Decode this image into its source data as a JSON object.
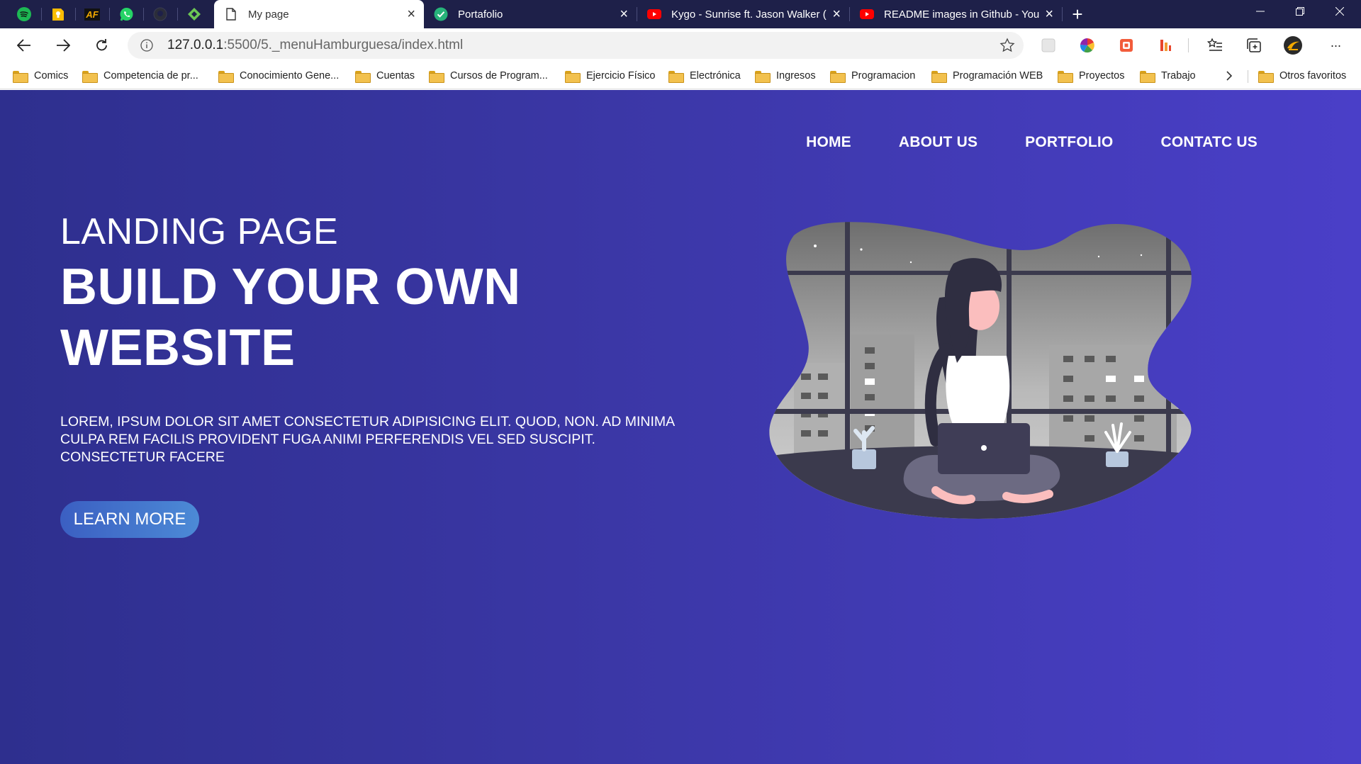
{
  "browser": {
    "tabs": [
      {
        "title": "My page",
        "active": true,
        "favicon": "page-icon"
      },
      {
        "title": "Portafolio",
        "active": false,
        "favicon": "check-circle-icon"
      },
      {
        "title": "Kygo - Sunrise ft. Jason Walker (O",
        "active": false,
        "favicon": "youtube-icon"
      },
      {
        "title": "README images in Github - You",
        "active": false,
        "favicon": "youtube-icon"
      }
    ],
    "pinned_tabs": [
      "spotify-icon",
      "keep-icon",
      "af-icon",
      "whatsapp-icon",
      "github-icon",
      "feedly-icon"
    ],
    "pinned_af_label": "AF",
    "close_glyph": "×",
    "new_tab_glyph": "+",
    "url": {
      "host": "127.0.0.1",
      "path": ":5500/5._menuHamburguesa/index.html"
    },
    "more_glyph": "···",
    "bookmarks": [
      "Comics",
      "Competencia de pr...",
      "Conocimiento Gene...",
      "Cuentas",
      "Cursos de Program...",
      "Ejercicio Físico",
      "Electrónica",
      "Ingresos",
      "Programacion",
      "Programación WEB",
      "Proyectos",
      "Trabajo"
    ],
    "other_bookmarks": "Otros favoritos",
    "colors": {
      "titlebar": "#1e2049",
      "accent": "#4a3fc8"
    }
  },
  "page": {
    "nav": [
      "HOME",
      "ABOUT US",
      "PORTFOLIO",
      "CONTATC US"
    ],
    "kicker": "LANDING PAGE",
    "title": "BUILD YOUR OWN WEBSITE",
    "text": "LOREM, IPSUM DOLOR SIT AMET CONSECTETUR ADIPISICING ELIT. QUOD, NON. AD MINIMA CULPA REM FACILIS PROVIDENT FUGA ANIMI PERFERENDIS VEL SED SUSCIPIT. CONSECTETUR FACERE",
    "cta": "LEARN MORE",
    "illustration": "woman-with-laptop-illustration",
    "colors": {
      "bg_start": "#2e2f8e",
      "bg_end": "#4a3fc8",
      "button": "#4c8ad6"
    }
  }
}
